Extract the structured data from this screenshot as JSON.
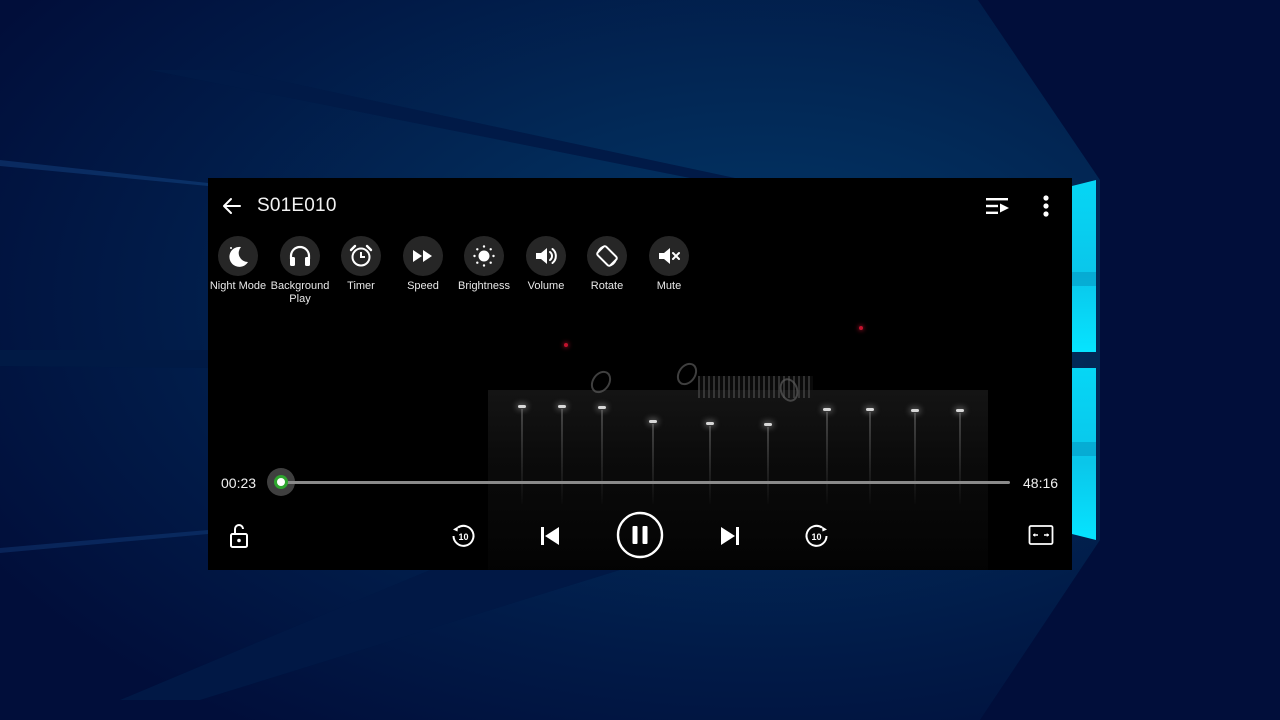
{
  "desktop": {
    "wallpaper": "windows-10-hero",
    "colors": {
      "base": "#010e3a",
      "glow": "#033869",
      "logo": "#06d6f5"
    }
  },
  "player": {
    "title": "S01E010",
    "icons": {
      "back": "arrow-left-icon",
      "playlist": "playlist-icon",
      "more": "more-vertical-icon",
      "lock": "unlock-icon",
      "rewind": "replay-10-icon",
      "previous": "skip-previous-icon",
      "play_pause": "pause-icon",
      "next": "skip-next-icon",
      "forward": "forward-10-icon",
      "aspect": "aspect-ratio-icon"
    },
    "quick_actions": [
      {
        "label": "Night Mode",
        "icon": "moon-icon"
      },
      {
        "label": "Background Play",
        "icon": "headphones-icon"
      },
      {
        "label": "Timer",
        "icon": "alarm-clock-icon"
      },
      {
        "label": "Speed",
        "icon": "fast-forward-icon"
      },
      {
        "label": "Brightness",
        "icon": "sun-icon"
      },
      {
        "label": "Volume",
        "icon": "volume-icon"
      },
      {
        "label": "Rotate",
        "icon": "screen-rotation-icon"
      },
      {
        "label": "Mute",
        "icon": "volume-mute-icon"
      }
    ],
    "playback": {
      "current_time": "00:23",
      "total_time": "48:16",
      "progress_fraction": 0.0079,
      "state": "playing",
      "seek_step_seconds": "10"
    },
    "colors": {
      "accent": "#2ea52e",
      "track": "#8a8a8a",
      "button_bg": "#262626",
      "text": "#f2f2f2"
    }
  }
}
